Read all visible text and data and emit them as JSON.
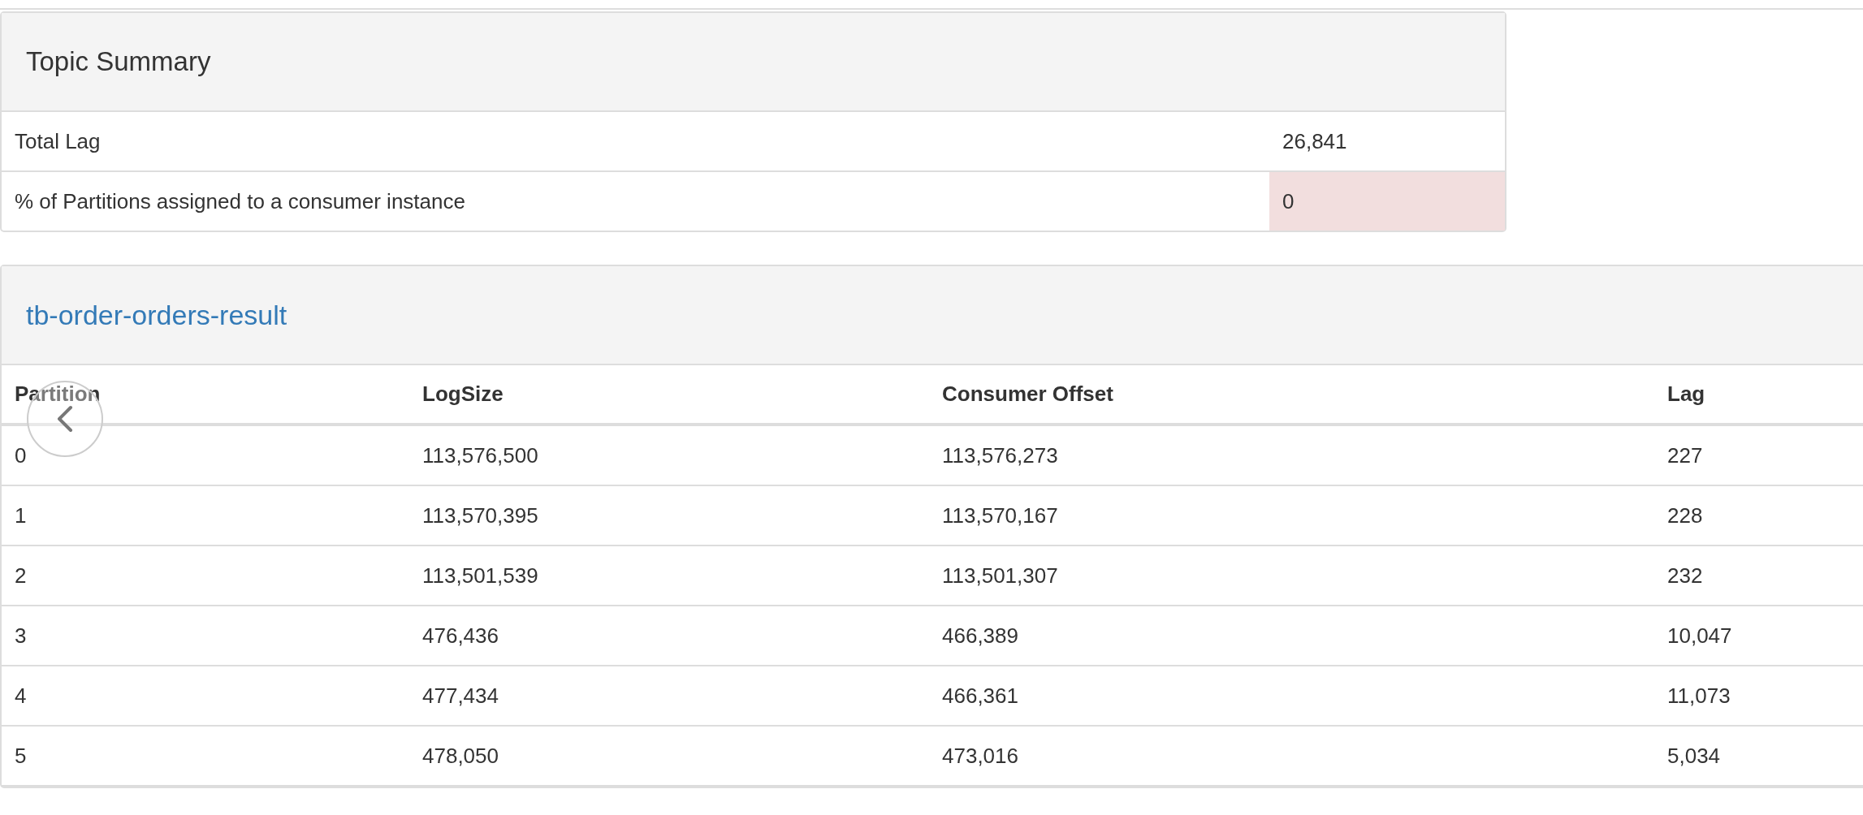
{
  "summary_panel": {
    "title": "Topic Summary",
    "rows": [
      {
        "label": "Total Lag",
        "value": "26,841",
        "warning": false
      },
      {
        "label": "% of Partitions assigned to a consumer instance",
        "value": "0",
        "warning": true
      }
    ]
  },
  "topic_panel": {
    "title": "tb-order-orders-result",
    "table": {
      "columns": [
        "Partition",
        "LogSize",
        "Consumer Offset",
        "Lag"
      ],
      "rows": [
        [
          "0",
          "113,576,500",
          "113,576,273",
          "227"
        ],
        [
          "1",
          "113,570,395",
          "113,570,167",
          "228"
        ],
        [
          "2",
          "113,501,539",
          "113,501,307",
          "232"
        ],
        [
          "3",
          "476,436",
          "466,389",
          "10,047"
        ],
        [
          "4",
          "477,434",
          "466,361",
          "11,073"
        ],
        [
          "5",
          "478,050",
          "473,016",
          "5,034"
        ]
      ]
    }
  }
}
